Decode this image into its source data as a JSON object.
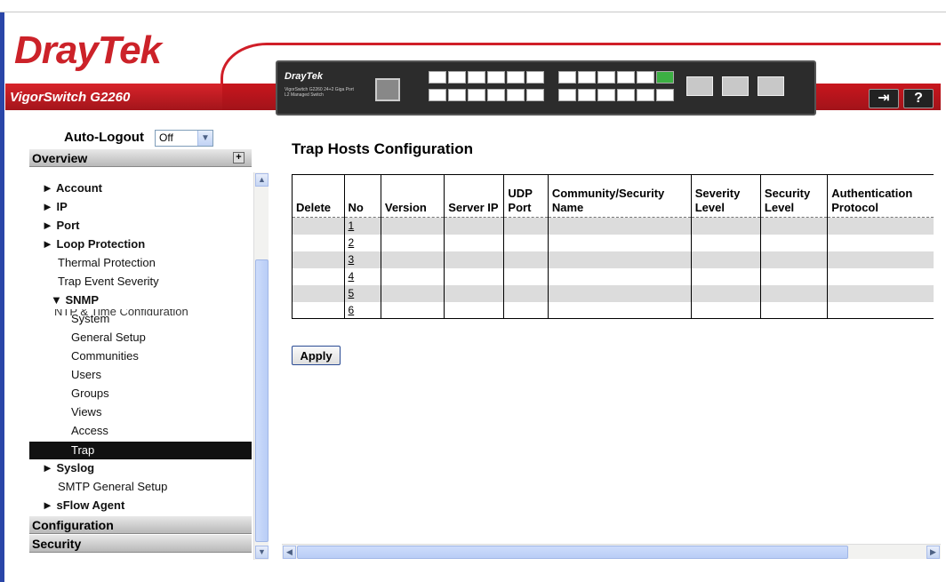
{
  "header": {
    "logo_dray": "Dray",
    "logo_tek": "Tek",
    "model_name": "VigorSwitch G2260",
    "device_logo": "DrayTek",
    "device_subtitle": "VigorSwitch G2260 24+2 Giga Port L2 Managed Switch",
    "logout_icon_glyph": "⇥",
    "help_icon_glyph": "?"
  },
  "sidebar": {
    "auto_logout_label": "Auto-Logout",
    "auto_logout_value": "Off",
    "sections": {
      "overview": "Overview",
      "configuration": "Configuration",
      "security": "Security"
    },
    "clipped_item": "NTP & Time Configuration",
    "items": [
      {
        "label": "► Account"
      },
      {
        "label": "► IP"
      },
      {
        "label": "► Port"
      },
      {
        "label": "► Loop Protection"
      },
      {
        "label": "Thermal Protection"
      },
      {
        "label": "Trap Event Severity"
      },
      {
        "label": "▼ SNMP"
      },
      {
        "label": "System"
      },
      {
        "label": "General Setup"
      },
      {
        "label": "Communities"
      },
      {
        "label": "Users"
      },
      {
        "label": "Groups"
      },
      {
        "label": "Views"
      },
      {
        "label": "Access"
      },
      {
        "label": "Trap"
      },
      {
        "label": "► Syslog"
      },
      {
        "label": "SMTP General Setup"
      },
      {
        "label": "► sFlow Agent"
      }
    ]
  },
  "main": {
    "title": "Trap Hosts Configuration",
    "columns": [
      "Delete",
      "No",
      "Version",
      "Server IP",
      "UDP Port",
      "Community/Security Name",
      "Severity Level",
      "Security Level",
      "Authentication Protocol"
    ],
    "rows": [
      {
        "no": "1"
      },
      {
        "no": "2"
      },
      {
        "no": "3"
      },
      {
        "no": "4"
      },
      {
        "no": "5"
      },
      {
        "no": "6"
      }
    ],
    "apply_label": "Apply"
  },
  "colors": {
    "brand_red": "#cc2229",
    "active_menu_bg": "#111111",
    "row_shade": "#dcdcdc"
  }
}
